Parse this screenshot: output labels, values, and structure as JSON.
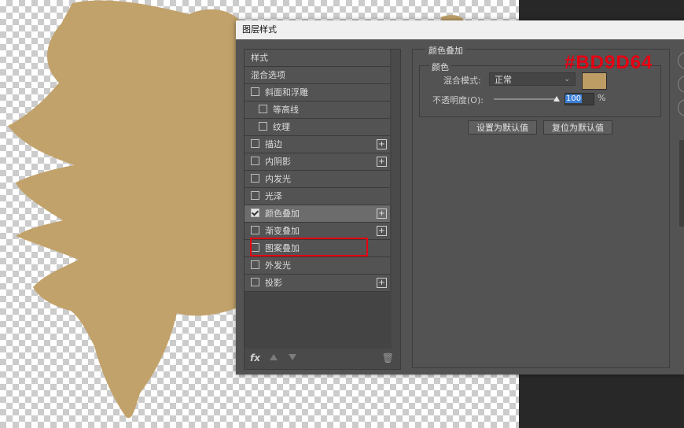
{
  "dialog": {
    "title": "图层样式"
  },
  "style_list": {
    "items": [
      {
        "label": "样式",
        "checkbox": false,
        "checked": false,
        "plus": false,
        "indent": false,
        "selected": false
      },
      {
        "label": "混合选项",
        "checkbox": false,
        "checked": false,
        "plus": false,
        "indent": false,
        "selected": false
      },
      {
        "label": "斜面和浮雕",
        "checkbox": true,
        "checked": false,
        "plus": false,
        "indent": false,
        "selected": false
      },
      {
        "label": "等高线",
        "checkbox": true,
        "checked": false,
        "plus": false,
        "indent": true,
        "selected": false
      },
      {
        "label": "纹理",
        "checkbox": true,
        "checked": false,
        "plus": false,
        "indent": true,
        "selected": false
      },
      {
        "label": "描边",
        "checkbox": true,
        "checked": false,
        "plus": true,
        "indent": false,
        "selected": false
      },
      {
        "label": "内阴影",
        "checkbox": true,
        "checked": false,
        "plus": true,
        "indent": false,
        "selected": false
      },
      {
        "label": "内发光",
        "checkbox": true,
        "checked": false,
        "plus": false,
        "indent": false,
        "selected": false
      },
      {
        "label": "光泽",
        "checkbox": true,
        "checked": false,
        "plus": false,
        "indent": false,
        "selected": false
      },
      {
        "label": "颜色叠加",
        "checkbox": true,
        "checked": true,
        "plus": true,
        "indent": false,
        "selected": true
      },
      {
        "label": "渐变叠加",
        "checkbox": true,
        "checked": false,
        "plus": true,
        "indent": false,
        "selected": false
      },
      {
        "label": "图案叠加",
        "checkbox": true,
        "checked": false,
        "plus": false,
        "indent": false,
        "selected": false
      },
      {
        "label": "外发光",
        "checkbox": true,
        "checked": false,
        "plus": false,
        "indent": false,
        "selected": false
      },
      {
        "label": "投影",
        "checkbox": true,
        "checked": false,
        "plus": true,
        "indent": false,
        "selected": false
      }
    ],
    "footer": {
      "fx_label": "fx",
      "up_icon": "arrow-up-icon",
      "down_icon": "arrow-down-icon",
      "trash_icon": "trash-icon",
      "trash_glyph": "🗑"
    }
  },
  "color_overlay": {
    "group_title": "颜色叠加",
    "sub_group_title": "颜色",
    "blend_mode_label": "混合模式:",
    "blend_mode_value": "正常",
    "opacity_label": "不透明度(O):",
    "opacity_value": "100",
    "opacity_unit": "%",
    "swatch_color": "#bd9d64",
    "set_default_button": "设置为默认值",
    "reset_default_button": "复位为默认值"
  },
  "annotation": {
    "hex_text": "#BD9D64",
    "color": "#e60012"
  },
  "canvas": {
    "shape_color": "#c2a26b"
  }
}
